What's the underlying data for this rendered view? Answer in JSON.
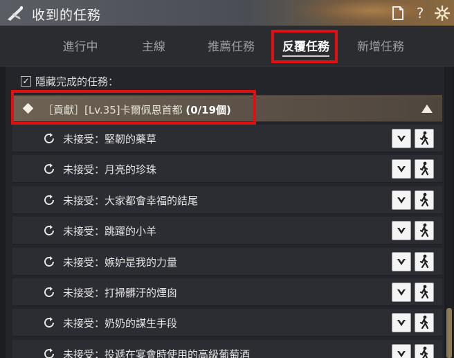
{
  "window": {
    "title": "收到的任務"
  },
  "titlebar_buttons": {
    "doc_icon": "document-icon",
    "help_label": "?",
    "close_icon": "emblem-close-icon"
  },
  "tabs": [
    {
      "label": "進行中",
      "active": false
    },
    {
      "label": "主線",
      "active": false
    },
    {
      "label": "推薦任務",
      "active": false
    },
    {
      "label": "反覆任務",
      "active": true
    },
    {
      "label": "新增任務",
      "active": false
    }
  ],
  "hide_completed": {
    "label": "隱藏完成的任務：",
    "checked": true,
    "check_glyph": "✓"
  },
  "group": {
    "title": "［貢獻］[Lv.35]卡爾佩恩首都 ",
    "count": "(0/19個)"
  },
  "quests": [
    {
      "label": "未接受：堅韌的藥草"
    },
    {
      "label": "未接受：月亮的珍珠"
    },
    {
      "label": "未接受：大家都會幸福的結尾"
    },
    {
      "label": "未接受：跳躍的小羊"
    },
    {
      "label": "未接受：嫉妒是我的力量"
    },
    {
      "label": "未接受：打掃髒汙的煙囪"
    },
    {
      "label": "未接受：奶奶的謀生手段"
    },
    {
      "label": "未接受：投遞在宴會時使用的高級葡萄酒"
    }
  ],
  "colors": {
    "highlight": "#e01010",
    "header_bg": "#6e6254",
    "panel_bg": "#24252a"
  }
}
